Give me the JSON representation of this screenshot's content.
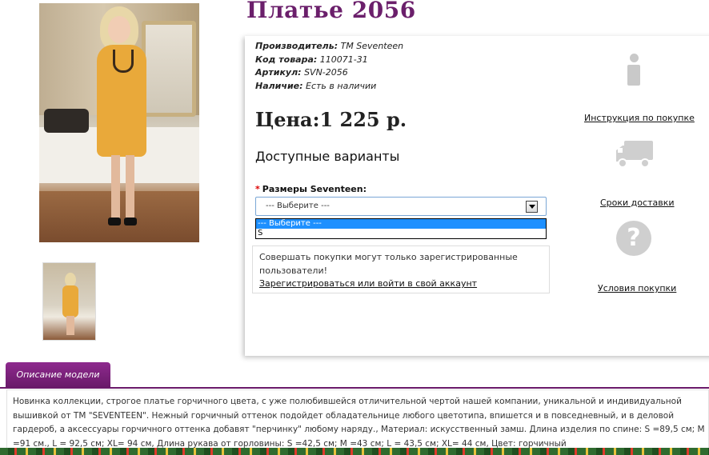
{
  "product": {
    "title": "Платье 2056",
    "specs": [
      {
        "label": "Производитель:",
        "value": "TM Seventeen"
      },
      {
        "label": "Код товара:",
        "value": "110071-31"
      },
      {
        "label": "Артикул:",
        "value": "SVN-2056"
      },
      {
        "label": "Наличие:",
        "value": "Есть в наличии"
      }
    ],
    "price": "Цена:1 225 р.",
    "variants_heading": "Доступные варианты",
    "size_required_mark": "*",
    "size_label": "Размеры Seventeen:",
    "size_select": {
      "selected": "--- Выберите ---",
      "options": [
        "--- Выберите ---",
        "S"
      ]
    },
    "notice": {
      "text": "Совершать покупки могут только зарегистрированные пользователи!",
      "link": "Зарегистрироваться или войти в свой аккаунт"
    }
  },
  "sidebar": {
    "items": [
      {
        "icon": "info-icon",
        "label": "Инструкция по покупке"
      },
      {
        "icon": "truck-icon",
        "label": "Сроки доставки"
      },
      {
        "icon": "question-icon",
        "label": "Условия покупки"
      }
    ]
  },
  "description": {
    "tab_label": "Описание модели",
    "text": "Новинка коллекции, строгое платье горчичного цвета, с уже полюбившейся отличительной чертой нашей компании, уникальной и индивидуальной вышивкой от TM \"SEVENTEEN\". Нежный горчичный оттенок подойдет обладательнице любого цветотипа, впишется и в повседневный, и в деловой гардероб, а аксессуары горчичного оттенка добавят \"перчинку\" любому наряду., Материал: искусственный замш. Длина изделия по спине: S =89,5 см; M =91 см., L = 92,5 см; XL= 94 см, Длина рукава от горловины: S =42,5 см; M =43 см; L = 43,5 см; XL= 44 см, Цвет: горчичный"
  },
  "colors": {
    "accent": "#6b1f6b",
    "selection": "#1e90ff",
    "required": "#dd0000"
  }
}
